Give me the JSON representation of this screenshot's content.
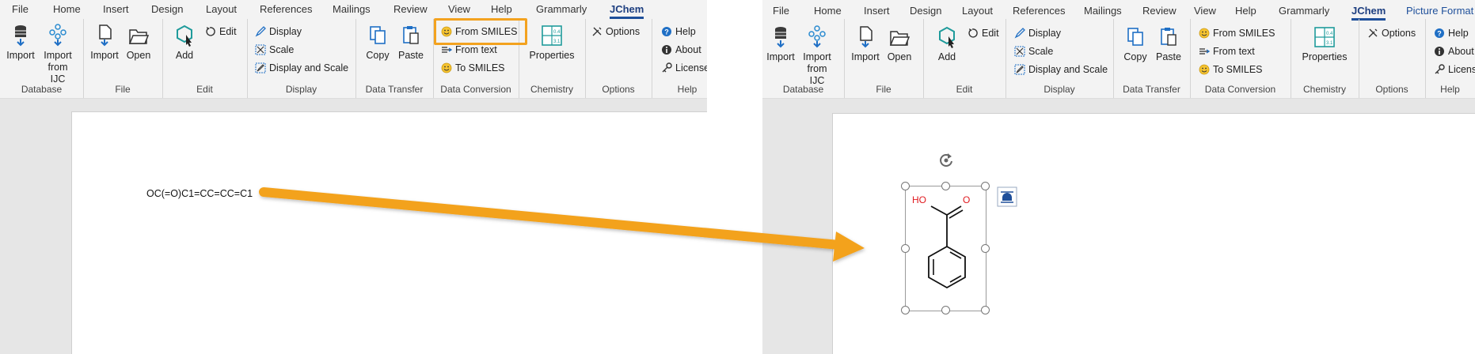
{
  "left": {
    "tabs": [
      "File",
      "Home",
      "Insert",
      "Design",
      "Layout",
      "References",
      "Mailings",
      "Review",
      "View",
      "Help",
      "Grammarly",
      "JChem"
    ],
    "active_tab": "JChem",
    "groups": {
      "database": {
        "label": "Database",
        "import_label": "Import",
        "import_ijc_line1": "Import",
        "import_ijc_line2": "from IJC"
      },
      "file": {
        "label": "File",
        "import_label": "Import",
        "open_label": "Open"
      },
      "edit": {
        "label": "Edit",
        "add_label": "Add",
        "edit_label": "Edit"
      },
      "display": {
        "label": "Display",
        "display_label": "Display",
        "scale_label": "Scale",
        "display_scale_label": "Display and Scale"
      },
      "data_transfer": {
        "label": "Data Transfer",
        "copy_label": "Copy",
        "paste_label": "Paste"
      },
      "data_conversion": {
        "label": "Data Conversion",
        "from_smiles_label": "From SMILES",
        "from_text_label": "From text",
        "to_smiles_label": "To SMILES"
      },
      "chemistry": {
        "label": "Chemistry",
        "properties_label": "Properties"
      },
      "options": {
        "label": "Options",
        "options_label": "Options"
      },
      "help": {
        "label": "Help",
        "help_label": "Help",
        "about_label": "About",
        "licenses_label": "Licenses"
      }
    },
    "document_text": "OC(=O)C1=CC=CC=C1",
    "highlight_color": "#f3a21f"
  },
  "right": {
    "tabs": [
      "File",
      "Home",
      "Insert",
      "Design",
      "Layout",
      "References",
      "Mailings",
      "Review",
      "View",
      "Help",
      "Grammarly",
      "JChem",
      "Picture Format"
    ],
    "active_tab": "JChem",
    "groups": {
      "database": {
        "label": "Database",
        "import_label": "Import",
        "import_ijc_line1": "Import",
        "import_ijc_line2": "from IJC"
      },
      "file": {
        "label": "File",
        "import_label": "Import",
        "open_label": "Open"
      },
      "edit": {
        "label": "Edit",
        "add_label": "Add",
        "edit_label": "Edit"
      },
      "display": {
        "label": "Display",
        "display_label": "Display",
        "scale_label": "Scale",
        "display_scale_label": "Display and Scale"
      },
      "data_transfer": {
        "label": "Data Transfer",
        "copy_label": "Copy",
        "paste_label": "Paste"
      },
      "data_conversion": {
        "label": "Data Conversion",
        "from_smiles_label": "From SMILES",
        "from_text_label": "From text",
        "to_smiles_label": "To SMILES"
      },
      "chemistry": {
        "label": "Chemistry",
        "properties_label": "Properties"
      },
      "options": {
        "label": "Options",
        "options_label": "Options"
      },
      "help": {
        "label": "Help",
        "help_label": "Help",
        "about_label": "About",
        "licenses_label": "Licenses"
      }
    },
    "molecule": {
      "ho_label": "HO",
      "o_label": "O"
    }
  },
  "arrow_color": "#f3a21f",
  "icons": [
    "database-icon",
    "network-icon",
    "import-file-icon",
    "open-folder-icon",
    "add-molecule-icon",
    "edit-icon",
    "display-icon",
    "scale-icon",
    "display-scale-icon",
    "copy-icon",
    "paste-icon",
    "smiles-smiley-icon",
    "from-text-icon",
    "properties-table-icon",
    "options-icon",
    "help-icon",
    "about-icon",
    "license-key-icon",
    "rotate-handle-icon",
    "layout-options-icon"
  ]
}
